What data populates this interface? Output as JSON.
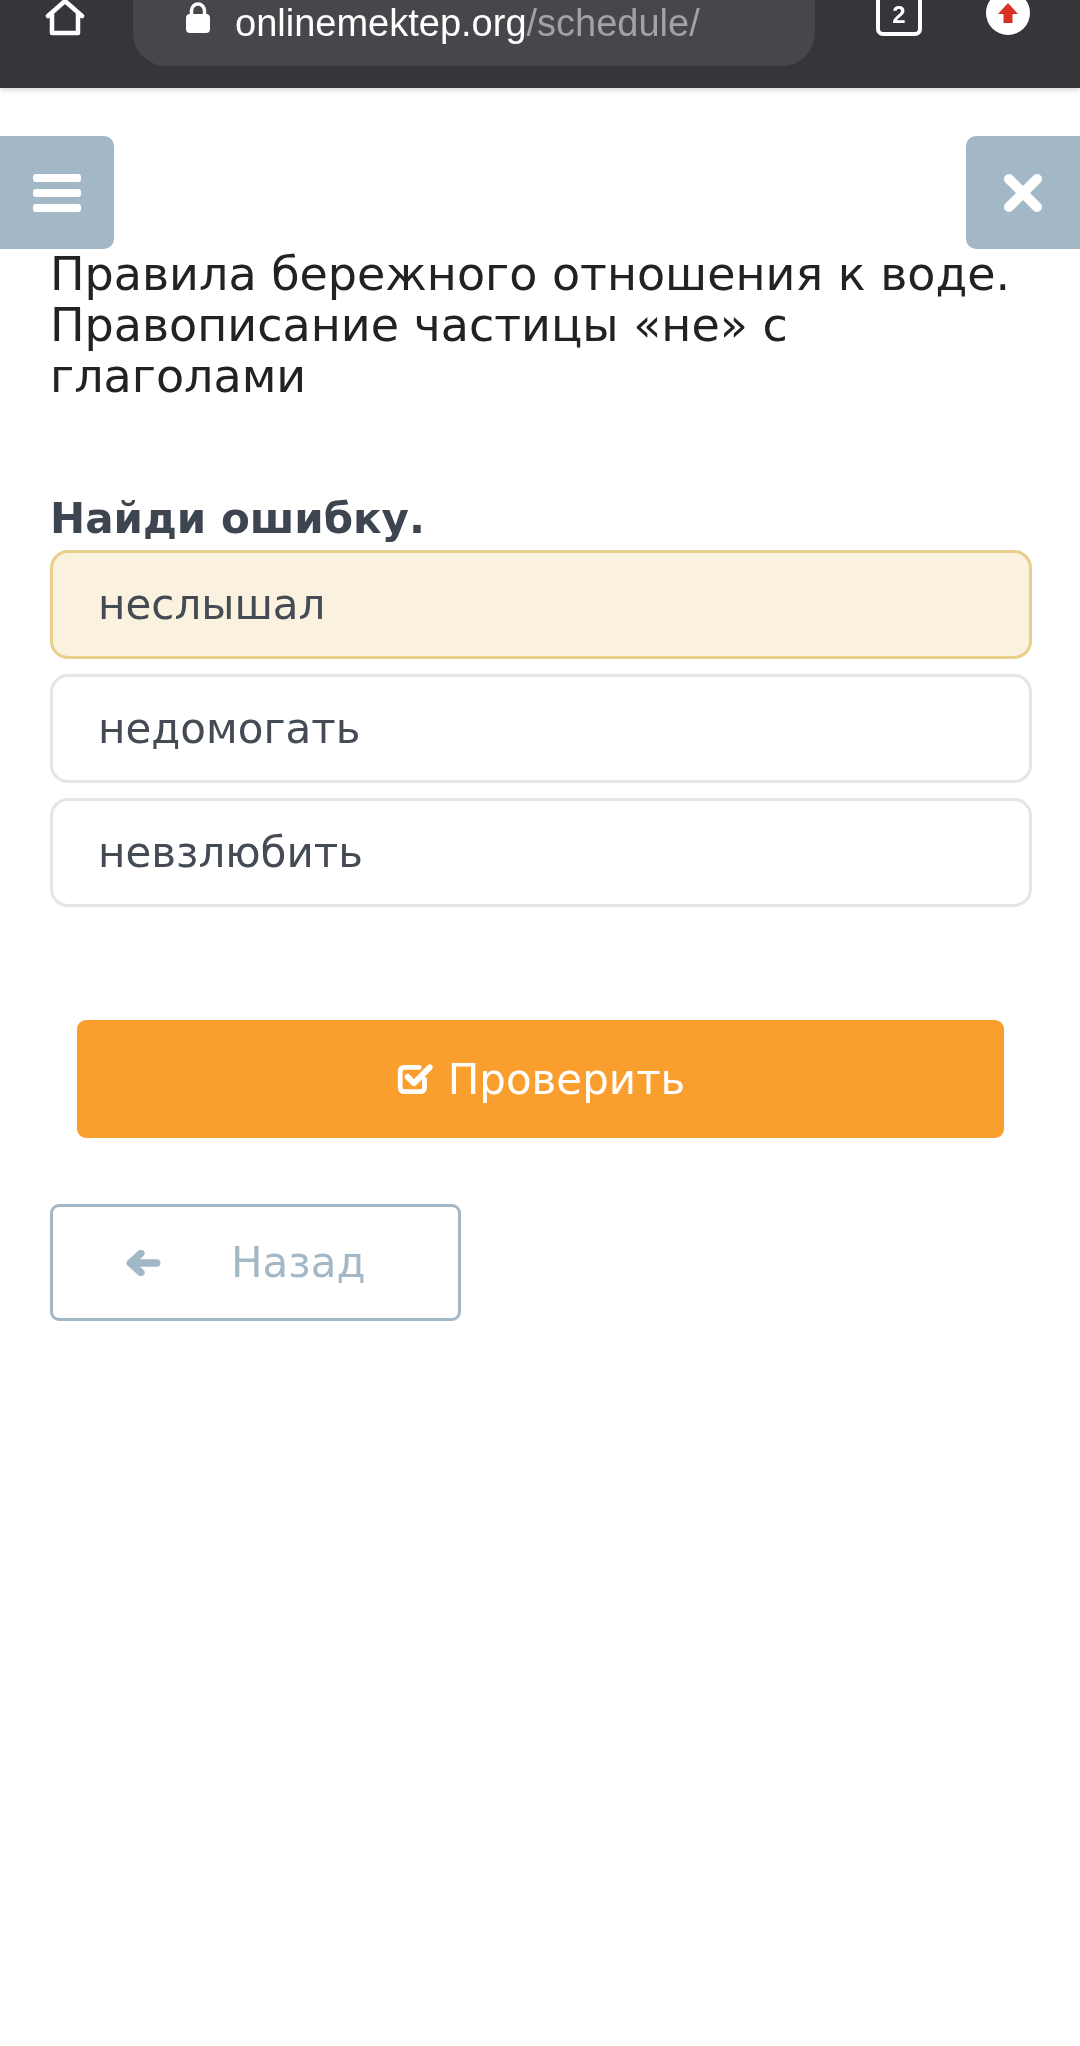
{
  "browser": {
    "url_host": "onlinemektep.org",
    "url_path": "/schedule/",
    "tab_count": "2"
  },
  "lesson": {
    "title": "Правила бережного отношения к воде. Правописание частицы «не» с глаголами"
  },
  "question": {
    "prompt": "Найди ошибку.",
    "options": [
      {
        "label": "неслышал",
        "selected": true
      },
      {
        "label": "недомогать",
        "selected": false
      },
      {
        "label": "невзлюбить",
        "selected": false
      }
    ]
  },
  "actions": {
    "check": "Проверить",
    "back": "Назад"
  }
}
